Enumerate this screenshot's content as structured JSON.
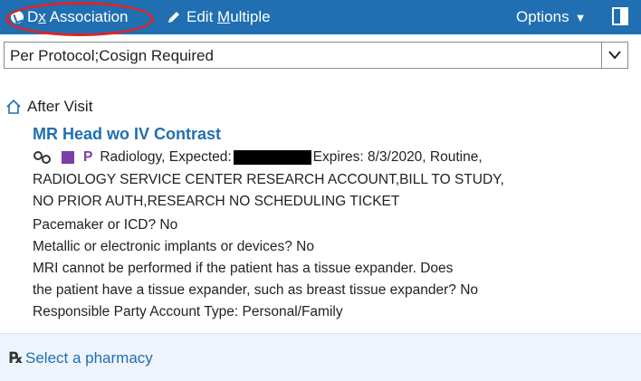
{
  "toolbar": {
    "dx_association_label_prefix": "D",
    "dx_association_label_underlined": "x",
    "dx_association_label_suffix": " Association",
    "edit_multiple_label_prefix": "Edit ",
    "edit_multiple_label_underlined": "M",
    "edit_multiple_label_suffix": "ultiple",
    "options_label": "Options",
    "options_caret": "▼",
    "accent_color": "#1f6fb2",
    "highlight_color": "#e02424"
  },
  "protocol_select": {
    "value": "Per Protocol;Cosign Required",
    "dropdown_glyph": "⌄"
  },
  "section": {
    "title": "After Visit",
    "icon": "home-icon"
  },
  "order": {
    "title": "MR Head wo IV Contrast",
    "priority_letter": "P",
    "line1_text": "Radiology, Expected:",
    "line1_after": " Expires: 8/3/2020, Routine,",
    "line2": "RADIOLOGY SERVICE CENTER RESEARCH ACCOUNT,BILL TO STUDY,",
    "line3": "NO PRIOR AUTH,RESEARCH NO SCHEDULING TICKET",
    "line4": "Pacemaker or ICD? No",
    "line5": "Metallic or electronic implants or devices? No",
    "line6": "MRI cannot be performed if the patient has a tissue expander. Does",
    "line7": "the patient have a tissue expander, such as breast tissue expander? No",
    "line8": "Responsible Party Account Type: Personal/Family"
  },
  "pharmacy": {
    "rx_symbol": "℞",
    "link_label": "Select a pharmacy"
  }
}
